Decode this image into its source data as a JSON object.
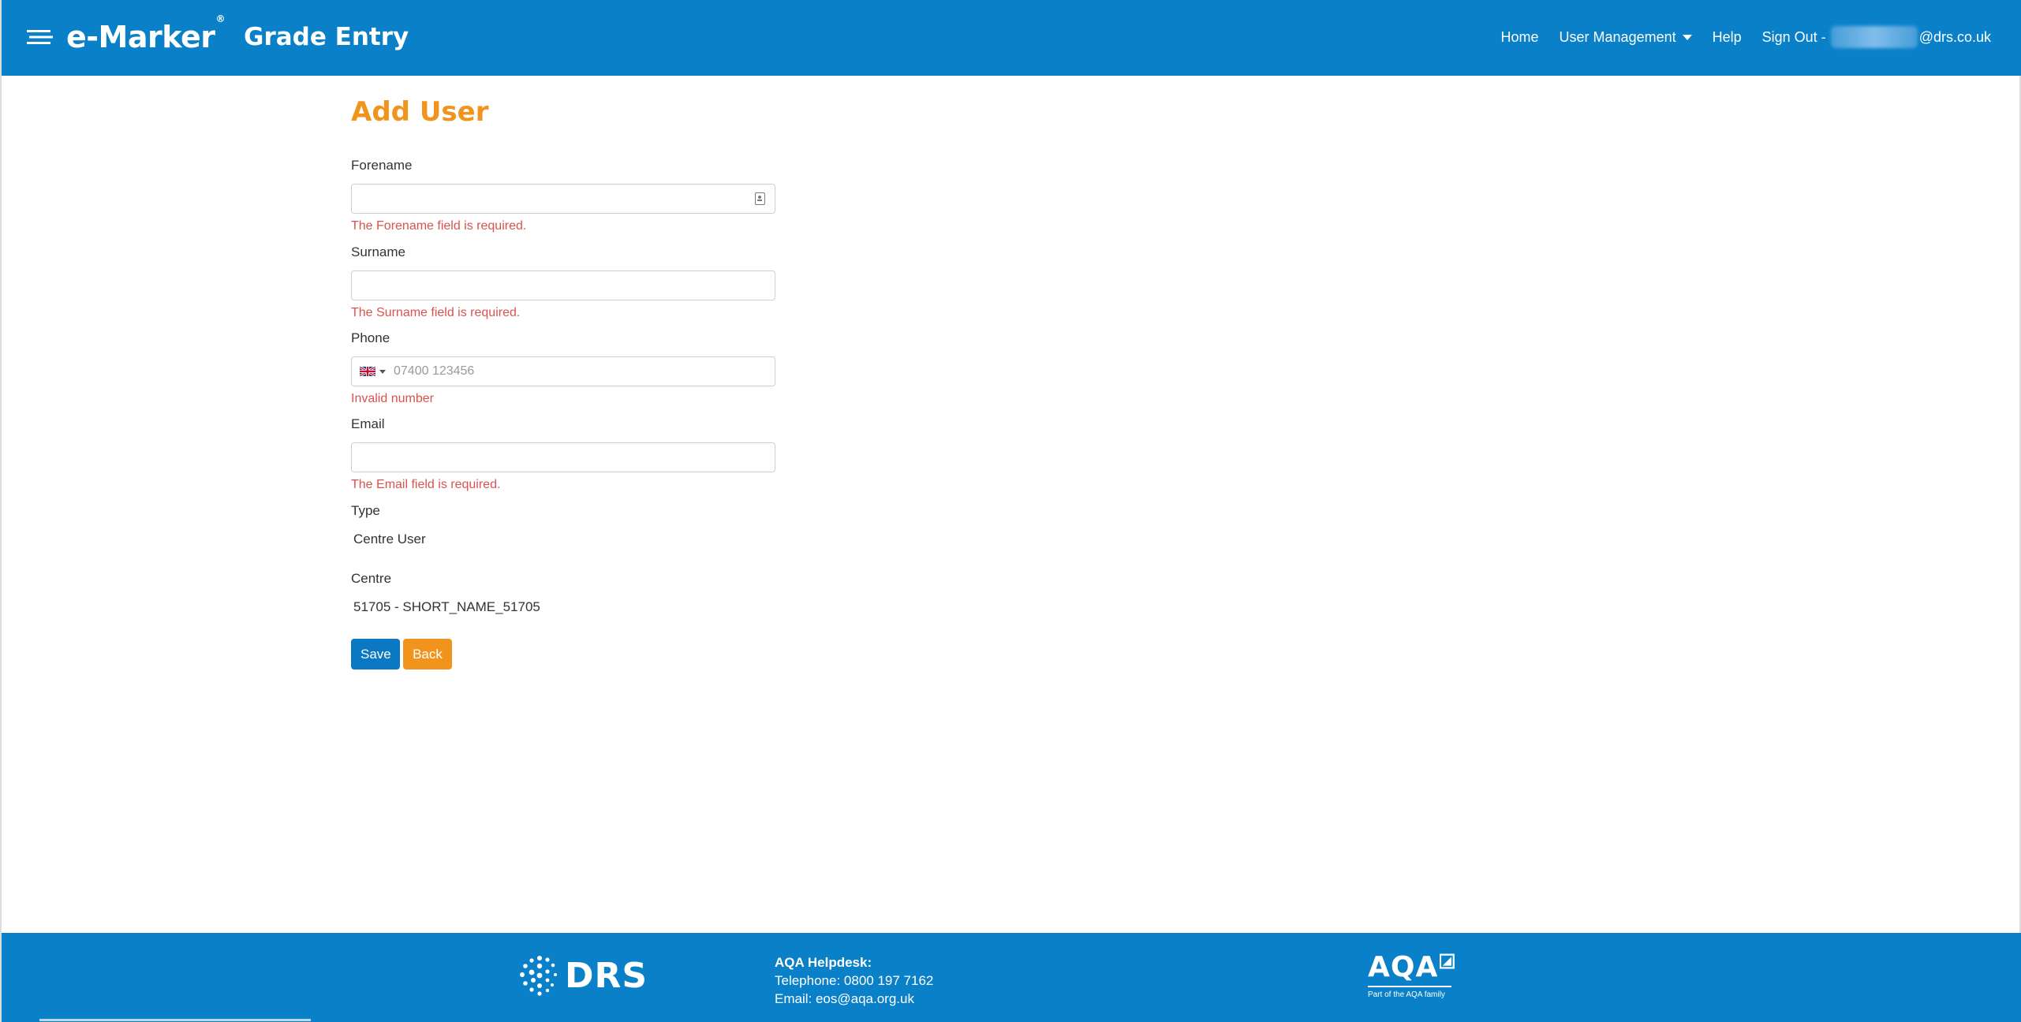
{
  "header": {
    "brand_name": "e-Marker",
    "brand_reg": "®",
    "brand_sub": "Grade Entry",
    "nav": {
      "home": "Home",
      "user_management": "User Management",
      "help": "Help",
      "sign_out": "Sign Out -",
      "user_email_suffix": "@drs.co.uk"
    }
  },
  "form": {
    "title": "Add User",
    "forename": {
      "label": "Forename",
      "value": "",
      "error": "The Forename field is required."
    },
    "surname": {
      "label": "Surname",
      "value": "",
      "error": "The Surname field is required."
    },
    "phone": {
      "label": "Phone",
      "value": "",
      "placeholder": "07400 123456",
      "error": "Invalid number",
      "country_icon": "uk-flag-icon"
    },
    "email": {
      "label": "Email",
      "value": "",
      "error": "The Email field is required."
    },
    "type": {
      "label": "Type",
      "value": "Centre User"
    },
    "centre": {
      "label": "Centre",
      "value": "51705 - SHORT_NAME_51705"
    },
    "buttons": {
      "save": "Save",
      "back": "Back"
    }
  },
  "footer": {
    "drs_logo_text": "DRS",
    "helpdesk_title": "AQA Helpdesk:",
    "helpdesk_phone": "Telephone: 0800 197 7162",
    "helpdesk_email": "Email: eos@aqa.org.uk",
    "aqa_logo_text": "AQA",
    "aqa_tagline": "Part of the AQA family"
  },
  "colors": {
    "header_bg": "#0a80c8",
    "title_orange": "#f0941e",
    "error_red": "#d9534f",
    "save_blue": "#0a78c2",
    "back_orange": "#f0941e"
  }
}
